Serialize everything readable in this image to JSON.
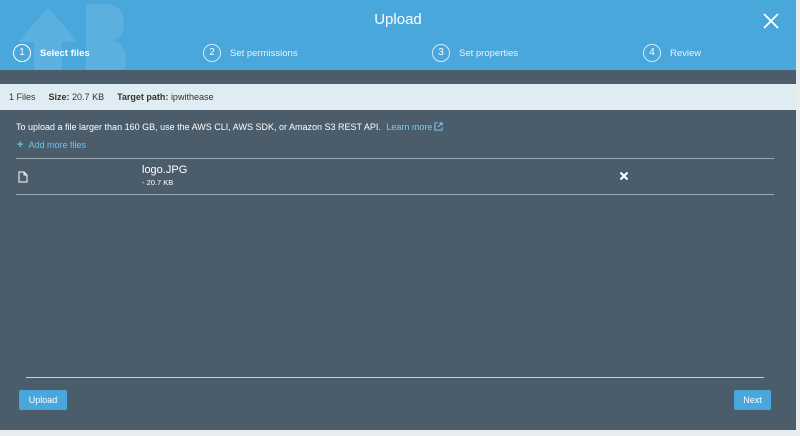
{
  "dialog": {
    "title": "Upload",
    "close_icon": "close-icon",
    "steps": [
      {
        "num": "1",
        "label": "Select files",
        "active": true
      },
      {
        "num": "2",
        "label": "Set permissions"
      },
      {
        "num": "3",
        "label": "Set properties"
      },
      {
        "num": "4",
        "label": "Review"
      }
    ]
  },
  "summary": {
    "files": "1 Files",
    "size_label": "Size:",
    "size_value": "20.7 KB",
    "path_label": "Target path:",
    "path_value": "ipwithease"
  },
  "info": {
    "text": "To upload a file larger than 160 GB, use the AWS CLI, AWS SDK, or Amazon S3 REST API.",
    "learn_more": "Learn more",
    "add_more": "Add more files"
  },
  "files": [
    {
      "name": "logo.JPG",
      "size": "- 20.7 KB",
      "icon": "file-icon",
      "remove_icon": "remove-icon"
    }
  ],
  "footer": {
    "upload_label": "Upload",
    "next_label": "Next"
  },
  "colors": {
    "header": "#49a7dc",
    "body": "#4b5d6a",
    "summary_bar": "#dfecf2",
    "link": "#7fc8f0"
  }
}
